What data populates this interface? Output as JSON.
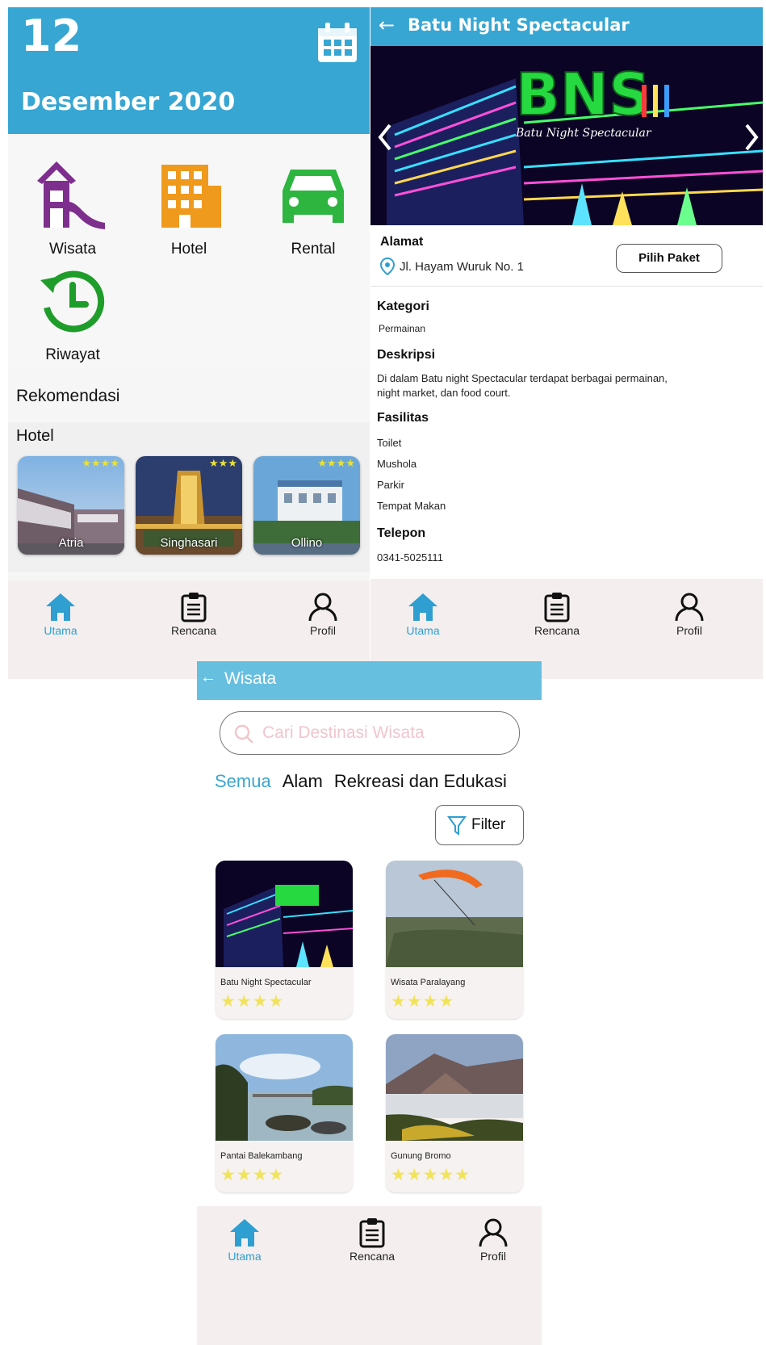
{
  "home": {
    "date_day": "12",
    "date_month_year": "Desember 2020",
    "menu": [
      {
        "label": "Wisata",
        "icon": "playground-icon",
        "color": "#7e2f8e"
      },
      {
        "label": "Hotel",
        "icon": "building-icon",
        "color": "#ef9a1c"
      },
      {
        "label": "Rental",
        "icon": "car-icon",
        "color": "#2db540"
      },
      {
        "label": "Riwayat",
        "icon": "history-icon",
        "color": "#1f9d2a"
      }
    ],
    "recommendation_title": "Rekomendasi",
    "hotel_section_title": "Hotel",
    "hotels": [
      {
        "name": "Atria",
        "stars": "★★★★"
      },
      {
        "name": "Singhasari",
        "stars": "★★★"
      },
      {
        "name": "Ollino",
        "stars": "★★★★"
      }
    ]
  },
  "nav": {
    "home": "Utama",
    "plan": "Rencana",
    "profile": "Profil"
  },
  "detail": {
    "back": "←",
    "title": "Batu Night Spectacular",
    "hero_sign": "BNS",
    "hero_sub": "Batu Night Spectacular",
    "address_label": "Alamat",
    "address": "Jl. Hayam Wuruk No. 1",
    "choose_package": "Pilih Paket",
    "category_label": "Kategori",
    "category": "Permainan",
    "description_label": "Deskripsi",
    "description_line1": "Di dalam Batu night Spectacular terdapat berbagai permainan,",
    "description_line2": "night market, dan food court.",
    "facilities_label": "Fasilitas",
    "facilities": [
      "Toilet",
      "Mushola",
      "Parkir",
      "Tempat Makan"
    ],
    "phone_label": "Telepon",
    "phone": "0341-5025111"
  },
  "wisata": {
    "back": "←",
    "title": "Wisata",
    "search_placeholder": "Cari Destinasi Wisata",
    "tabs": [
      "Semua",
      "Alam",
      "Rekreasi dan Edukasi"
    ],
    "filter_label": "Filter",
    "items": [
      {
        "name": "Batu Night Spectacular",
        "stars": "★★★★"
      },
      {
        "name": "Wisata Paralayang",
        "stars": "★★★★"
      },
      {
        "name": "Pantai Balekambang",
        "stars": "★★★★"
      },
      {
        "name": "Gunung Bromo",
        "stars": "★★★★★"
      }
    ]
  },
  "colors": {
    "primary": "#37a6d3",
    "primary_light": "#67bfe0",
    "star": "#e8e23a",
    "nav_bg": "#f4efee"
  }
}
